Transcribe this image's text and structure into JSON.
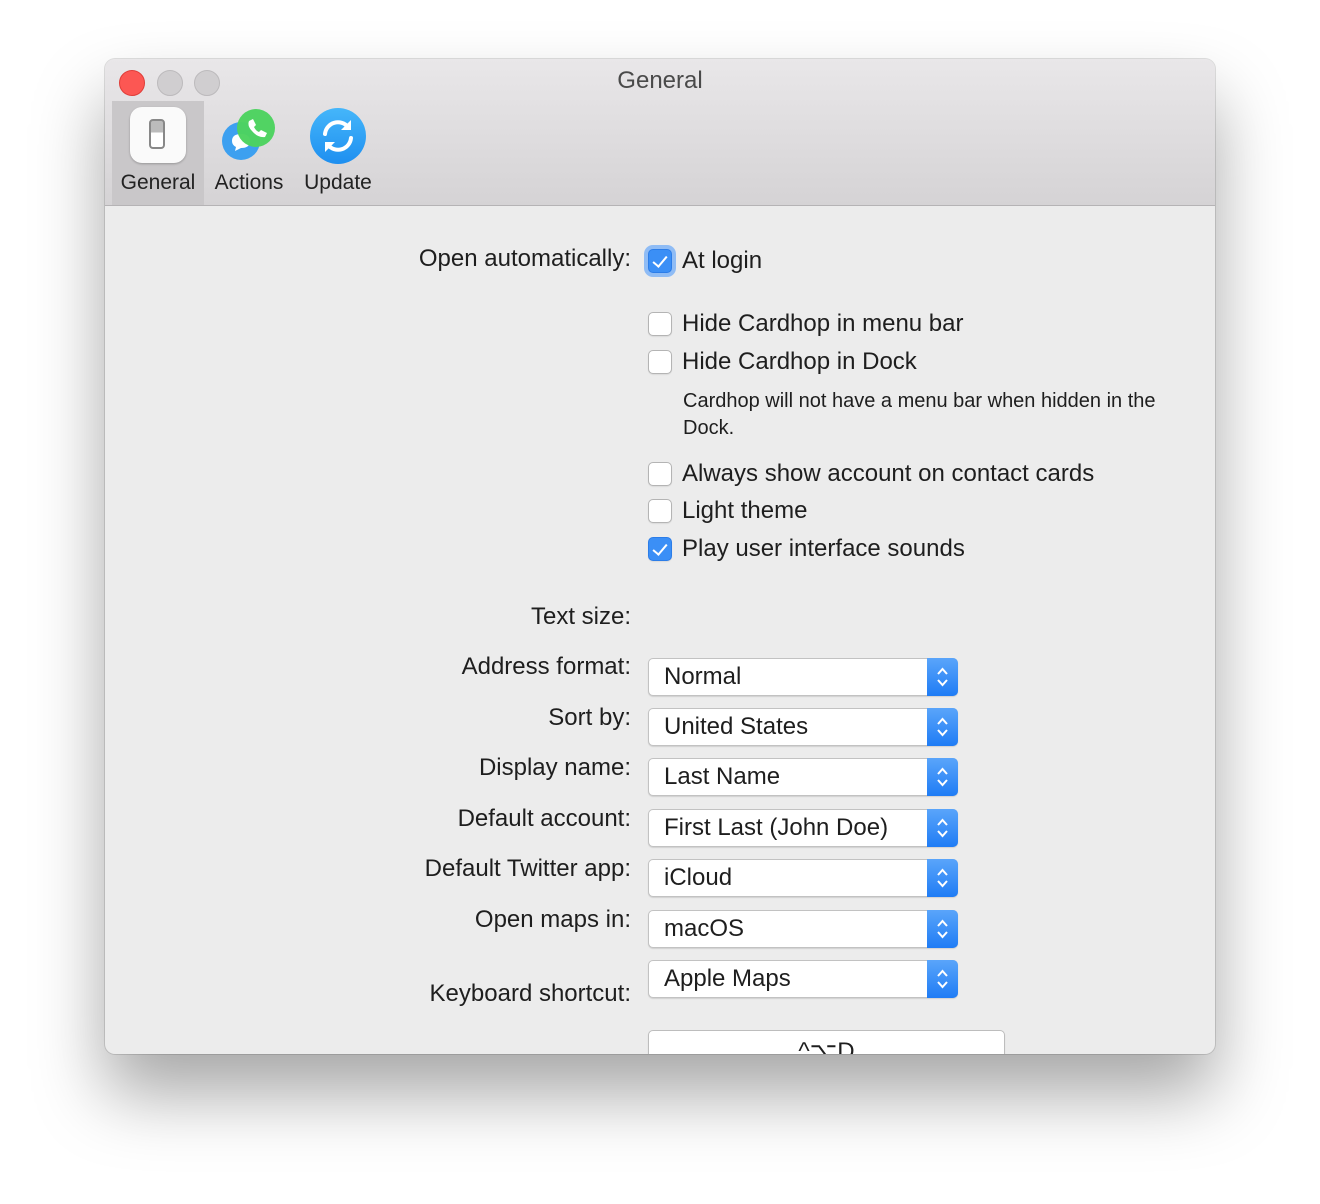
{
  "window": {
    "title": "General",
    "toolbar_tabs": [
      {
        "label": "General",
        "icon": "toggle-switch-icon",
        "active": true
      },
      {
        "label": "Actions",
        "icon": "phone-message-icon",
        "active": false
      },
      {
        "label": "Update",
        "icon": "refresh-icon",
        "active": false
      }
    ]
  },
  "general": {
    "open_automatically_label": "Open automatically:",
    "checkboxes": [
      {
        "label": "At login",
        "checked": true
      },
      {
        "label": "Hide Cardhop in menu bar",
        "checked": false
      },
      {
        "label": "Hide Cardhop in Dock",
        "checked": false
      },
      {
        "label": "Always show account on contact cards",
        "checked": false
      },
      {
        "label": "Light theme",
        "checked": false
      },
      {
        "label": "Play user interface sounds",
        "checked": true
      }
    ],
    "dock_note": "Cardhop will not have a menu bar when hidden in the Dock.",
    "selects": [
      {
        "label": "Text size:",
        "value": "Normal"
      },
      {
        "label": "Address format:",
        "value": "United States"
      },
      {
        "label": "Sort by:",
        "value": "Last Name"
      },
      {
        "label": "Display name:",
        "value": "First Last (John Doe)"
      },
      {
        "label": "Default account:",
        "value": "iCloud"
      },
      {
        "label": "Default Twitter app:",
        "value": "macOS"
      },
      {
        "label": "Open maps in:",
        "value": "Apple Maps"
      }
    ],
    "keyboard_shortcut_label": "Keyboard shortcut:",
    "keyboard_shortcut_value": "^⌥D"
  },
  "colors": {
    "accent": "#3b8ff6",
    "close_button": "#fc5753"
  }
}
